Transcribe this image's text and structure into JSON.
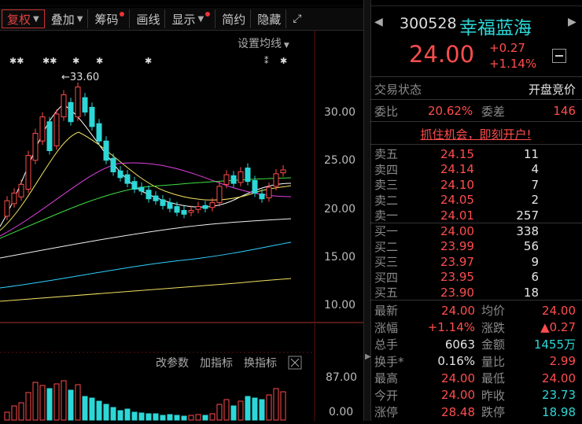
{
  "toolbar": {
    "buttons": [
      "复权",
      "叠加",
      "筹码",
      "画线",
      "显示",
      "简约",
      "隐藏"
    ],
    "settings_label": "设置均线",
    "indicator_buttons": [
      "改参数",
      "加指标",
      "换指标"
    ]
  },
  "chart": {
    "price_labels": [
      "30.00",
      "25.00",
      "20.00",
      "15.00",
      "10.00"
    ],
    "peak_label": "←33.60",
    "volume_labels": [
      "87.00",
      "0.00"
    ]
  },
  "quote": {
    "code": "300528",
    "name": "幸福蓝海",
    "price": "24.00",
    "change": "+0.27",
    "change_pct": "+1.14%",
    "trade_status_label": "交易状态",
    "trade_status_value": "开盘竞价",
    "weibi_label": "委比",
    "weibi_value": "20.62%",
    "weicha_label": "委差",
    "weicha_value": "146",
    "promo": "抓住机会，即刻开户!"
  },
  "order_book": {
    "asks": [
      {
        "label": "卖五",
        "price": "24.15",
        "vol": "11"
      },
      {
        "label": "卖四",
        "price": "24.14",
        "vol": "4"
      },
      {
        "label": "卖三",
        "price": "24.10",
        "vol": "7"
      },
      {
        "label": "卖二",
        "price": "24.05",
        "vol": "2"
      },
      {
        "label": "卖一",
        "price": "24.01",
        "vol": "257"
      }
    ],
    "bids": [
      {
        "label": "买一",
        "price": "24.00",
        "vol": "338"
      },
      {
        "label": "买二",
        "price": "23.99",
        "vol": "56"
      },
      {
        "label": "买三",
        "price": "23.97",
        "vol": "9"
      },
      {
        "label": "买四",
        "price": "23.95",
        "vol": "6"
      },
      {
        "label": "买五",
        "price": "23.90",
        "vol": "18"
      }
    ]
  },
  "stats": [
    {
      "l1": "最新",
      "v1": "24.00",
      "l2": "均价",
      "v2": "24.00"
    },
    {
      "l1": "涨幅",
      "v1": "+1.14%",
      "l2": "涨跌",
      "v2": "▲0.27"
    },
    {
      "l1": "总手",
      "v1": "6063",
      "l2": "金额",
      "v2": "1455万"
    },
    {
      "l1": "换手*",
      "v1": "0.16%",
      "l2": "量比",
      "v2": "2.99"
    },
    {
      "l1": "最高",
      "v1": "24.00",
      "l2": "最低",
      "v2": "24.00"
    },
    {
      "l1": "今开",
      "v1": "24.00",
      "l2": "昨收",
      "v2": "23.73"
    },
    {
      "l1": "涨停",
      "v1": "28.48",
      "l2": "跌停",
      "v2": "18.98"
    }
  ],
  "colors": {
    "up": "#ff4d4d",
    "down": "#2dd7d7",
    "accent": "#2dd7d7"
  }
}
